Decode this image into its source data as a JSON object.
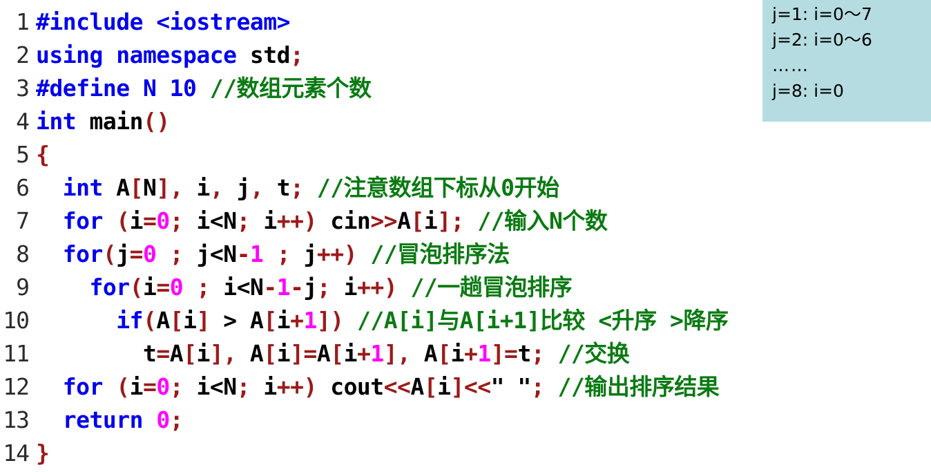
{
  "editor": {
    "language": "C++",
    "background_color": "#ffffff",
    "colors": {
      "keyword": "#0000ee",
      "punctuation": "#9c1a1a",
      "number": "#ff00ff",
      "comment": "#0a7a12",
      "text": "#000000",
      "line_number": "#2b2b2b"
    },
    "lines": [
      {
        "number": "1",
        "tokens": [
          {
            "kind": "pre",
            "text": "#include <iostream>"
          }
        ]
      },
      {
        "number": "2",
        "tokens": [
          {
            "kind": "kw",
            "text": "using namespace "
          },
          {
            "kind": "txt",
            "text": "std"
          },
          {
            "kind": "pun",
            "text": ";"
          }
        ]
      },
      {
        "number": "3",
        "tokens": [
          {
            "kind": "pre",
            "text": "#define N 10 "
          },
          {
            "kind": "cmt",
            "text": "//数组元素个数"
          }
        ]
      },
      {
        "number": "4",
        "tokens": [
          {
            "kind": "kw",
            "text": "int "
          },
          {
            "kind": "txt",
            "text": "main"
          },
          {
            "kind": "pun",
            "text": "()"
          }
        ]
      },
      {
        "number": "5",
        "tokens": [
          {
            "kind": "pun",
            "text": "{"
          }
        ]
      },
      {
        "number": "6",
        "tokens": [
          {
            "kind": "txt",
            "text": "  "
          },
          {
            "kind": "kw",
            "text": "int "
          },
          {
            "kind": "txt",
            "text": "A"
          },
          {
            "kind": "pun",
            "text": "["
          },
          {
            "kind": "txt",
            "text": "N"
          },
          {
            "kind": "pun",
            "text": "],"
          },
          {
            "kind": "txt",
            "text": " i"
          },
          {
            "kind": "pun",
            "text": ","
          },
          {
            "kind": "txt",
            "text": " j"
          },
          {
            "kind": "pun",
            "text": ","
          },
          {
            "kind": "txt",
            "text": " t"
          },
          {
            "kind": "pun",
            "text": ";"
          },
          {
            "kind": "txt",
            "text": " "
          },
          {
            "kind": "cmt",
            "text": "//注意数组下标从0开始"
          }
        ]
      },
      {
        "number": "7",
        "tokens": [
          {
            "kind": "txt",
            "text": "  "
          },
          {
            "kind": "kw",
            "text": "for "
          },
          {
            "kind": "pun",
            "text": "("
          },
          {
            "kind": "txt",
            "text": "i"
          },
          {
            "kind": "pun",
            "text": "="
          },
          {
            "kind": "num",
            "text": "0"
          },
          {
            "kind": "pun",
            "text": ";"
          },
          {
            "kind": "txt",
            "text": " i<N"
          },
          {
            "kind": "pun",
            "text": ";"
          },
          {
            "kind": "txt",
            "text": " i"
          },
          {
            "kind": "pun",
            "text": "++)"
          },
          {
            "kind": "txt",
            "text": " cin"
          },
          {
            "kind": "pun",
            "text": ">>"
          },
          {
            "kind": "txt",
            "text": "A"
          },
          {
            "kind": "pun",
            "text": "["
          },
          {
            "kind": "txt",
            "text": "i"
          },
          {
            "kind": "pun",
            "text": "];"
          },
          {
            "kind": "txt",
            "text": " "
          },
          {
            "kind": "cmt",
            "text": "//输入N个数"
          }
        ]
      },
      {
        "number": "8",
        "tokens": [
          {
            "kind": "txt",
            "text": "  "
          },
          {
            "kind": "kw",
            "text": "for"
          },
          {
            "kind": "pun",
            "text": "("
          },
          {
            "kind": "txt",
            "text": "j"
          },
          {
            "kind": "pun",
            "text": "="
          },
          {
            "kind": "num",
            "text": "0"
          },
          {
            "kind": "txt",
            "text": " "
          },
          {
            "kind": "pun",
            "text": ";"
          },
          {
            "kind": "txt",
            "text": " j<N"
          },
          {
            "kind": "pun",
            "text": "-"
          },
          {
            "kind": "num",
            "text": "1"
          },
          {
            "kind": "txt",
            "text": " "
          },
          {
            "kind": "pun",
            "text": ";"
          },
          {
            "kind": "txt",
            "text": " j"
          },
          {
            "kind": "pun",
            "text": "++)"
          },
          {
            "kind": "txt",
            "text": " "
          },
          {
            "kind": "cmt",
            "text": "//冒泡排序法"
          }
        ]
      },
      {
        "number": "9",
        "tokens": [
          {
            "kind": "txt",
            "text": "    "
          },
          {
            "kind": "kw",
            "text": "for"
          },
          {
            "kind": "pun",
            "text": "("
          },
          {
            "kind": "txt",
            "text": "i"
          },
          {
            "kind": "pun",
            "text": "="
          },
          {
            "kind": "num",
            "text": "0"
          },
          {
            "kind": "txt",
            "text": " "
          },
          {
            "kind": "pun",
            "text": ";"
          },
          {
            "kind": "txt",
            "text": " i<N"
          },
          {
            "kind": "pun",
            "text": "-"
          },
          {
            "kind": "num",
            "text": "1"
          },
          {
            "kind": "pun",
            "text": "-"
          },
          {
            "kind": "txt",
            "text": "j"
          },
          {
            "kind": "pun",
            "text": ";"
          },
          {
            "kind": "txt",
            "text": " i"
          },
          {
            "kind": "pun",
            "text": "++)"
          },
          {
            "kind": "txt",
            "text": " "
          },
          {
            "kind": "cmt",
            "text": "//一趟冒泡排序"
          }
        ]
      },
      {
        "number": "10",
        "tokens": [
          {
            "kind": "txt",
            "text": "      "
          },
          {
            "kind": "kw",
            "text": "if"
          },
          {
            "kind": "pun",
            "text": "("
          },
          {
            "kind": "txt",
            "text": "A"
          },
          {
            "kind": "pun",
            "text": "["
          },
          {
            "kind": "txt",
            "text": "i"
          },
          {
            "kind": "pun",
            "text": "]"
          },
          {
            "kind": "txt",
            "text": " > A"
          },
          {
            "kind": "pun",
            "text": "["
          },
          {
            "kind": "txt",
            "text": "i"
          },
          {
            "kind": "pun",
            "text": "+"
          },
          {
            "kind": "num",
            "text": "1"
          },
          {
            "kind": "pun",
            "text": "])"
          },
          {
            "kind": "txt",
            "text": " "
          },
          {
            "kind": "cmt",
            "text": "//A[i]与A[i+1]比较 <升序 >降序"
          }
        ]
      },
      {
        "number": "11",
        "tokens": [
          {
            "kind": "txt",
            "text": "        t"
          },
          {
            "kind": "pun",
            "text": "="
          },
          {
            "kind": "txt",
            "text": "A"
          },
          {
            "kind": "pun",
            "text": "["
          },
          {
            "kind": "txt",
            "text": "i"
          },
          {
            "kind": "pun",
            "text": "],"
          },
          {
            "kind": "txt",
            "text": " A"
          },
          {
            "kind": "pun",
            "text": "["
          },
          {
            "kind": "txt",
            "text": "i"
          },
          {
            "kind": "pun",
            "text": "]="
          },
          {
            "kind": "txt",
            "text": "A"
          },
          {
            "kind": "pun",
            "text": "["
          },
          {
            "kind": "txt",
            "text": "i"
          },
          {
            "kind": "pun",
            "text": "+"
          },
          {
            "kind": "num",
            "text": "1"
          },
          {
            "kind": "pun",
            "text": "],"
          },
          {
            "kind": "txt",
            "text": " A"
          },
          {
            "kind": "pun",
            "text": "["
          },
          {
            "kind": "txt",
            "text": "i"
          },
          {
            "kind": "pun",
            "text": "+"
          },
          {
            "kind": "num",
            "text": "1"
          },
          {
            "kind": "pun",
            "text": "]="
          },
          {
            "kind": "txt",
            "text": "t"
          },
          {
            "kind": "pun",
            "text": ";"
          },
          {
            "kind": "txt",
            "text": " "
          },
          {
            "kind": "cmt",
            "text": "//交换"
          }
        ]
      },
      {
        "number": "12",
        "tokens": [
          {
            "kind": "txt",
            "text": "  "
          },
          {
            "kind": "kw",
            "text": "for "
          },
          {
            "kind": "pun",
            "text": "("
          },
          {
            "kind": "txt",
            "text": "i"
          },
          {
            "kind": "pun",
            "text": "="
          },
          {
            "kind": "num",
            "text": "0"
          },
          {
            "kind": "pun",
            "text": ";"
          },
          {
            "kind": "txt",
            "text": " i<N"
          },
          {
            "kind": "pun",
            "text": ";"
          },
          {
            "kind": "txt",
            "text": " i"
          },
          {
            "kind": "pun",
            "text": "++)"
          },
          {
            "kind": "txt",
            "text": " cout"
          },
          {
            "kind": "pun",
            "text": "<<"
          },
          {
            "kind": "txt",
            "text": "A"
          },
          {
            "kind": "pun",
            "text": "["
          },
          {
            "kind": "txt",
            "text": "i"
          },
          {
            "kind": "pun",
            "text": "]"
          },
          {
            "kind": "pun",
            "text": "<<"
          },
          {
            "kind": "str",
            "text": "\" \""
          },
          {
            "kind": "pun",
            "text": ";"
          },
          {
            "kind": "txt",
            "text": " "
          },
          {
            "kind": "cmt",
            "text": "//输出排序结果"
          }
        ]
      },
      {
        "number": "13",
        "tokens": [
          {
            "kind": "txt",
            "text": "  "
          },
          {
            "kind": "kw",
            "text": "return "
          },
          {
            "kind": "num",
            "text": "0"
          },
          {
            "kind": "pun",
            "text": ";"
          }
        ]
      },
      {
        "number": "14",
        "tokens": [
          {
            "kind": "pun",
            "text": "}"
          }
        ]
      }
    ]
  },
  "annotation": {
    "background_color": "#b5dde1",
    "lines": [
      "j=1: i=0～7",
      "j=2: i=0～6",
      "……",
      "j=8: i=0"
    ]
  }
}
